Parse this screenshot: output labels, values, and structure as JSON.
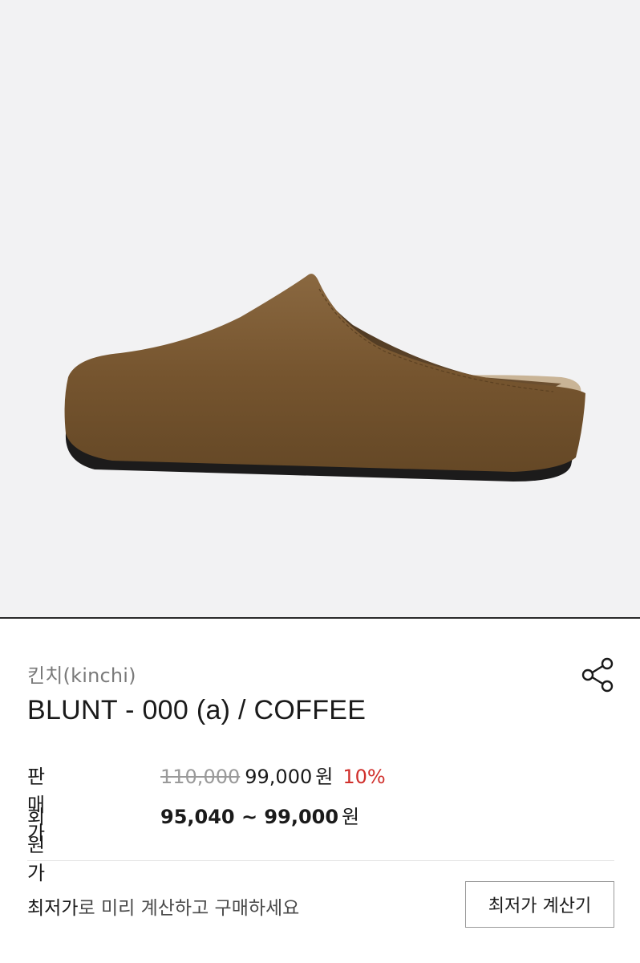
{
  "product": {
    "image_alt": "coffee suede mule",
    "brand": "킨치(kinchi)",
    "name": "BLUNT - 000 (a) / COFFEE"
  },
  "pricing": {
    "sale_label": "판매가",
    "original_price": "110,000",
    "sale_price": "99,000",
    "currency": "원",
    "discount": "10%",
    "member_label": "회원가",
    "member_range": "95,040 ~ 99,000",
    "member_currency": "원"
  },
  "lowest_price": {
    "strong_text": "최저가",
    "rest_text": "로 미리 계산하고 구매하세요",
    "button_label": "최저가 계산기"
  },
  "icons": {
    "share": "share-icon"
  },
  "colors": {
    "discount": "#d0302c",
    "suede": "#7a5a36",
    "sole": "#1c1b1b",
    "hero_bg": "#f2f2f3"
  }
}
